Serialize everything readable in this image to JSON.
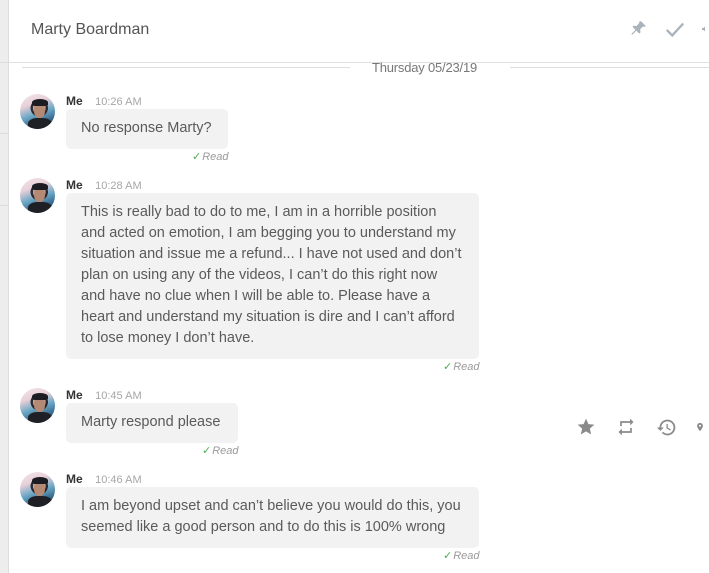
{
  "header": {
    "title": "Marty Boardman",
    "actions": [
      {
        "name": "pin-icon",
        "label": "Pin"
      },
      {
        "name": "check-icon",
        "label": "Mark done"
      },
      {
        "name": "volume-icon",
        "label": "Mute"
      }
    ]
  },
  "date_divider": "Thursday 05/23/19",
  "messages": [
    {
      "sender": "Me",
      "time": "10:26 AM",
      "text": "No response Marty?",
      "status": "Read"
    },
    {
      "sender": "Me",
      "time": "10:28 AM",
      "text": "This is really bad to do to me, I am in a horrible position and acted on emotion, I am begging you to understand my situation and issue me a refund... I have not used and don’t plan on using any of the videos, I can’t do this right now and have no clue when I will be able to. Please have a heart and understand my situation is dire and I can’t afford to lose money I don’t have.",
      "status": "Read"
    },
    {
      "sender": "Me",
      "time": "10:45 AM",
      "text": "Marty respond please",
      "status": "Read"
    },
    {
      "sender": "Me",
      "time": "10:46 AM",
      "text": "I am beyond upset and can’t believe you would do this, you seemed like a good person and to do this is 100% wrong",
      "status": "Read"
    }
  ],
  "side_actions": [
    {
      "name": "star-icon",
      "label": "Star"
    },
    {
      "name": "repeat-icon",
      "label": "Repeat"
    },
    {
      "name": "history-icon",
      "label": "History"
    },
    {
      "name": "location-icon",
      "label": "Location"
    }
  ],
  "colors": {
    "bubble": "#f2f2f2",
    "read_check": "#4caf50",
    "icon_gray": "#9e9e9e"
  }
}
